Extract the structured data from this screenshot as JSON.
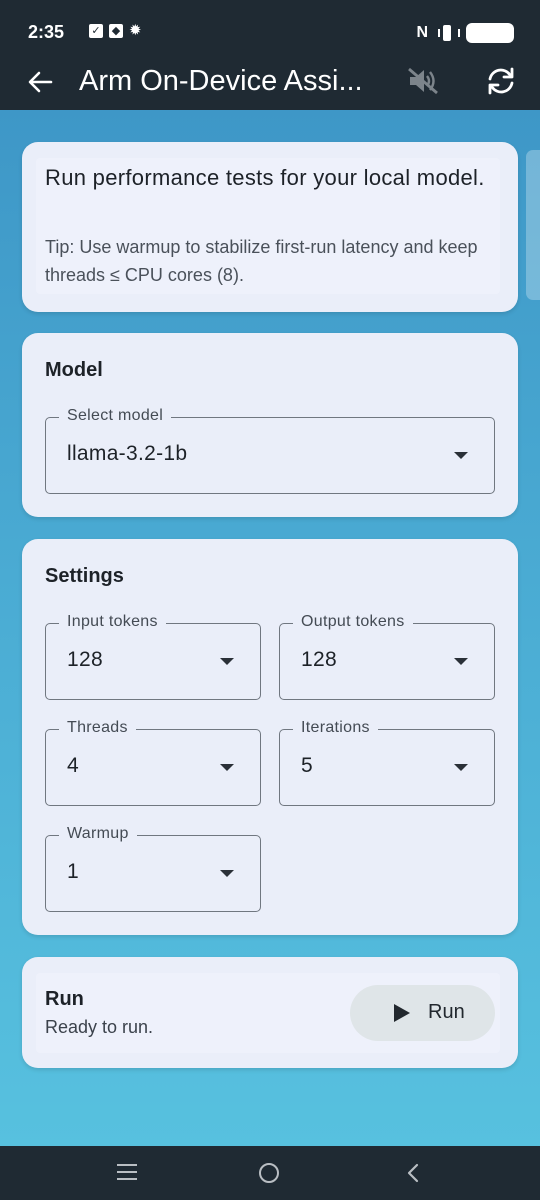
{
  "status_bar": {
    "time": "2:35"
  },
  "app_bar": {
    "title": "Arm On-Device Assi..."
  },
  "intro": {
    "text": "Run performance tests for your local model.",
    "tip": "Tip: Use warmup to stabilize first-run latency and keep threads ≤ CPU cores (8)."
  },
  "model": {
    "title": "Model",
    "select_label": "Select model",
    "select_value": "llama-3.2-1b"
  },
  "settings": {
    "title": "Settings",
    "input_tokens": {
      "label": "Input tokens",
      "value": "128"
    },
    "output_tokens": {
      "label": "Output tokens",
      "value": "128"
    },
    "threads": {
      "label": "Threads",
      "value": "4"
    },
    "iterations": {
      "label": "Iterations",
      "value": "5"
    },
    "warmup": {
      "label": "Warmup",
      "value": "1"
    }
  },
  "run": {
    "title": "Run",
    "status": "Ready to run.",
    "button_label": "Run"
  },
  "colors": {
    "bar_bg": "#1f2a33",
    "card_bg": "#eaeef9",
    "gradient_top": "#3e97c7",
    "gradient_bottom": "#57c1df"
  }
}
